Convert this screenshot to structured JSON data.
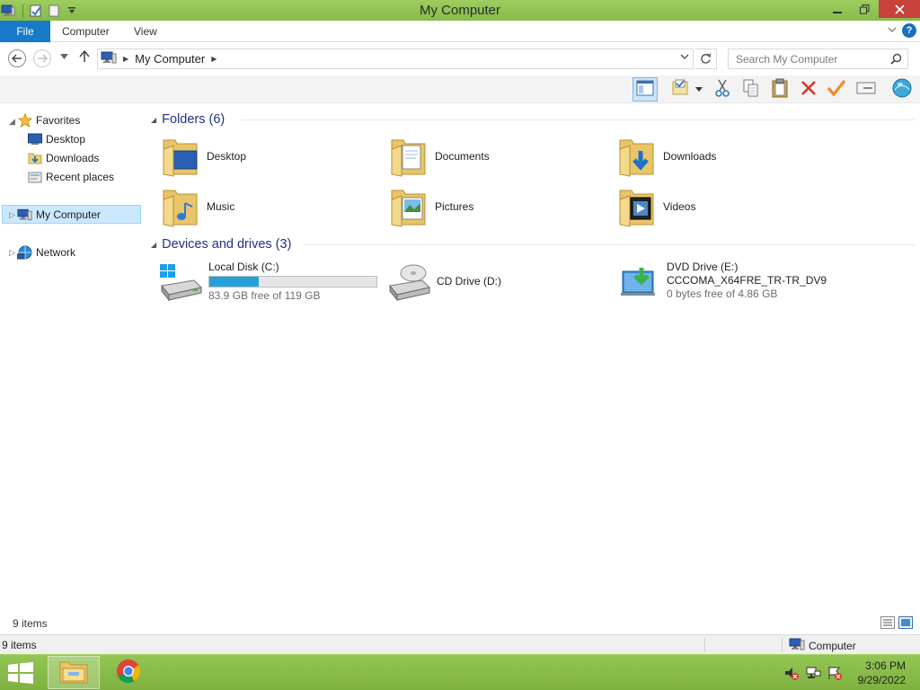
{
  "window": {
    "title": "My Computer"
  },
  "ribbon": {
    "tabs": [
      {
        "label": "File"
      },
      {
        "label": "Computer"
      },
      {
        "label": "View"
      }
    ],
    "help_icon": "?"
  },
  "address_bar": {
    "crumbs": [
      "My Computer"
    ],
    "search_placeholder": "Search My Computer"
  },
  "toolbar": {
    "buttons": [
      "preview-pane-icon",
      "properties-icon",
      "cut-icon",
      "copy-icon",
      "paste-icon",
      "delete-icon",
      "rename-icon",
      "map-drive-icon",
      "globe-icon"
    ]
  },
  "nav_pane": {
    "favorites": {
      "label": "Favorites",
      "items": [
        {
          "label": "Desktop",
          "icon": "desktop-icon"
        },
        {
          "label": "Downloads",
          "icon": "downloads-folder-icon"
        },
        {
          "label": "Recent places",
          "icon": "recent-places-icon"
        }
      ]
    },
    "my_computer": {
      "label": "My Computer",
      "selected": true
    },
    "network": {
      "label": "Network"
    }
  },
  "content": {
    "folders_group": {
      "title": "Folders (6)",
      "items": [
        {
          "name": "Desktop",
          "icon": "desktop-folder-icon"
        },
        {
          "name": "Documents",
          "icon": "documents-folder-icon"
        },
        {
          "name": "Downloads",
          "icon": "downloads-folder-icon"
        },
        {
          "name": "Music",
          "icon": "music-folder-icon"
        },
        {
          "name": "Pictures",
          "icon": "pictures-folder-icon"
        },
        {
          "name": "Videos",
          "icon": "videos-folder-icon"
        }
      ]
    },
    "drives_group": {
      "title": "Devices and drives (3)",
      "items": [
        {
          "name": "Local Disk (C:)",
          "free": "83.9 GB free of 119 GB",
          "used_fraction": 0.295,
          "icon": "hard-drive-icon"
        },
        {
          "name": "CD Drive (D:)",
          "icon": "cd-drive-icon"
        },
        {
          "name": "DVD Drive (E:)",
          "label2": "CCCOMA_X64FRE_TR-TR_DV9",
          "free": "0 bytes free of 4.86 GB",
          "icon": "dvd-drive-icon"
        }
      ]
    }
  },
  "status": {
    "items_count": "9 items",
    "footer_count": "9 items",
    "zone": "Computer"
  },
  "taskbar": {
    "apps": [
      "file-explorer-icon",
      "chrome-icon"
    ],
    "time": "3:06 PM",
    "date": "9/29/2022"
  },
  "colors": {
    "titlebar": "#8cc152",
    "file_tab": "#1979ca",
    "group_title": "#1e3287",
    "progress_fill": "#26a0da",
    "close_button": "#c7423b",
    "selection": "#cce8ff"
  }
}
